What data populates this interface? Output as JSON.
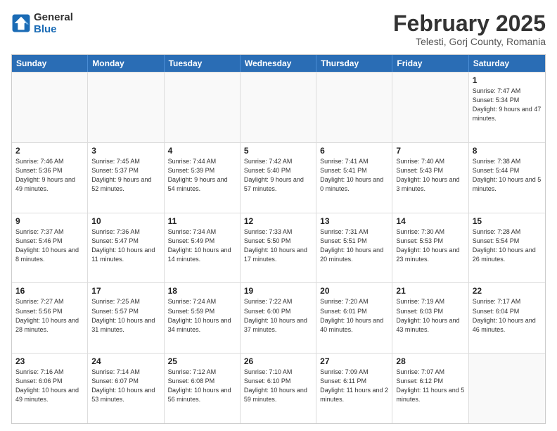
{
  "logo": {
    "line1": "General",
    "line2": "Blue"
  },
  "title": "February 2025",
  "location": "Telesti, Gorj County, Romania",
  "headers": [
    "Sunday",
    "Monday",
    "Tuesday",
    "Wednesday",
    "Thursday",
    "Friday",
    "Saturday"
  ],
  "rows": [
    [
      {
        "day": "",
        "info": ""
      },
      {
        "day": "",
        "info": ""
      },
      {
        "day": "",
        "info": ""
      },
      {
        "day": "",
        "info": ""
      },
      {
        "day": "",
        "info": ""
      },
      {
        "day": "",
        "info": ""
      },
      {
        "day": "1",
        "info": "Sunrise: 7:47 AM\nSunset: 5:34 PM\nDaylight: 9 hours and 47 minutes."
      }
    ],
    [
      {
        "day": "2",
        "info": "Sunrise: 7:46 AM\nSunset: 5:36 PM\nDaylight: 9 hours and 49 minutes."
      },
      {
        "day": "3",
        "info": "Sunrise: 7:45 AM\nSunset: 5:37 PM\nDaylight: 9 hours and 52 minutes."
      },
      {
        "day": "4",
        "info": "Sunrise: 7:44 AM\nSunset: 5:39 PM\nDaylight: 9 hours and 54 minutes."
      },
      {
        "day": "5",
        "info": "Sunrise: 7:42 AM\nSunset: 5:40 PM\nDaylight: 9 hours and 57 minutes."
      },
      {
        "day": "6",
        "info": "Sunrise: 7:41 AM\nSunset: 5:41 PM\nDaylight: 10 hours and 0 minutes."
      },
      {
        "day": "7",
        "info": "Sunrise: 7:40 AM\nSunset: 5:43 PM\nDaylight: 10 hours and 3 minutes."
      },
      {
        "day": "8",
        "info": "Sunrise: 7:38 AM\nSunset: 5:44 PM\nDaylight: 10 hours and 5 minutes."
      }
    ],
    [
      {
        "day": "9",
        "info": "Sunrise: 7:37 AM\nSunset: 5:46 PM\nDaylight: 10 hours and 8 minutes."
      },
      {
        "day": "10",
        "info": "Sunrise: 7:36 AM\nSunset: 5:47 PM\nDaylight: 10 hours and 11 minutes."
      },
      {
        "day": "11",
        "info": "Sunrise: 7:34 AM\nSunset: 5:49 PM\nDaylight: 10 hours and 14 minutes."
      },
      {
        "day": "12",
        "info": "Sunrise: 7:33 AM\nSunset: 5:50 PM\nDaylight: 10 hours and 17 minutes."
      },
      {
        "day": "13",
        "info": "Sunrise: 7:31 AM\nSunset: 5:51 PM\nDaylight: 10 hours and 20 minutes."
      },
      {
        "day": "14",
        "info": "Sunrise: 7:30 AM\nSunset: 5:53 PM\nDaylight: 10 hours and 23 minutes."
      },
      {
        "day": "15",
        "info": "Sunrise: 7:28 AM\nSunset: 5:54 PM\nDaylight: 10 hours and 26 minutes."
      }
    ],
    [
      {
        "day": "16",
        "info": "Sunrise: 7:27 AM\nSunset: 5:56 PM\nDaylight: 10 hours and 28 minutes."
      },
      {
        "day": "17",
        "info": "Sunrise: 7:25 AM\nSunset: 5:57 PM\nDaylight: 10 hours and 31 minutes."
      },
      {
        "day": "18",
        "info": "Sunrise: 7:24 AM\nSunset: 5:59 PM\nDaylight: 10 hours and 34 minutes."
      },
      {
        "day": "19",
        "info": "Sunrise: 7:22 AM\nSunset: 6:00 PM\nDaylight: 10 hours and 37 minutes."
      },
      {
        "day": "20",
        "info": "Sunrise: 7:20 AM\nSunset: 6:01 PM\nDaylight: 10 hours and 40 minutes."
      },
      {
        "day": "21",
        "info": "Sunrise: 7:19 AM\nSunset: 6:03 PM\nDaylight: 10 hours and 43 minutes."
      },
      {
        "day": "22",
        "info": "Sunrise: 7:17 AM\nSunset: 6:04 PM\nDaylight: 10 hours and 46 minutes."
      }
    ],
    [
      {
        "day": "23",
        "info": "Sunrise: 7:16 AM\nSunset: 6:06 PM\nDaylight: 10 hours and 49 minutes."
      },
      {
        "day": "24",
        "info": "Sunrise: 7:14 AM\nSunset: 6:07 PM\nDaylight: 10 hours and 53 minutes."
      },
      {
        "day": "25",
        "info": "Sunrise: 7:12 AM\nSunset: 6:08 PM\nDaylight: 10 hours and 56 minutes."
      },
      {
        "day": "26",
        "info": "Sunrise: 7:10 AM\nSunset: 6:10 PM\nDaylight: 10 hours and 59 minutes."
      },
      {
        "day": "27",
        "info": "Sunrise: 7:09 AM\nSunset: 6:11 PM\nDaylight: 11 hours and 2 minutes."
      },
      {
        "day": "28",
        "info": "Sunrise: 7:07 AM\nSunset: 6:12 PM\nDaylight: 11 hours and 5 minutes."
      },
      {
        "day": "",
        "info": ""
      }
    ]
  ]
}
